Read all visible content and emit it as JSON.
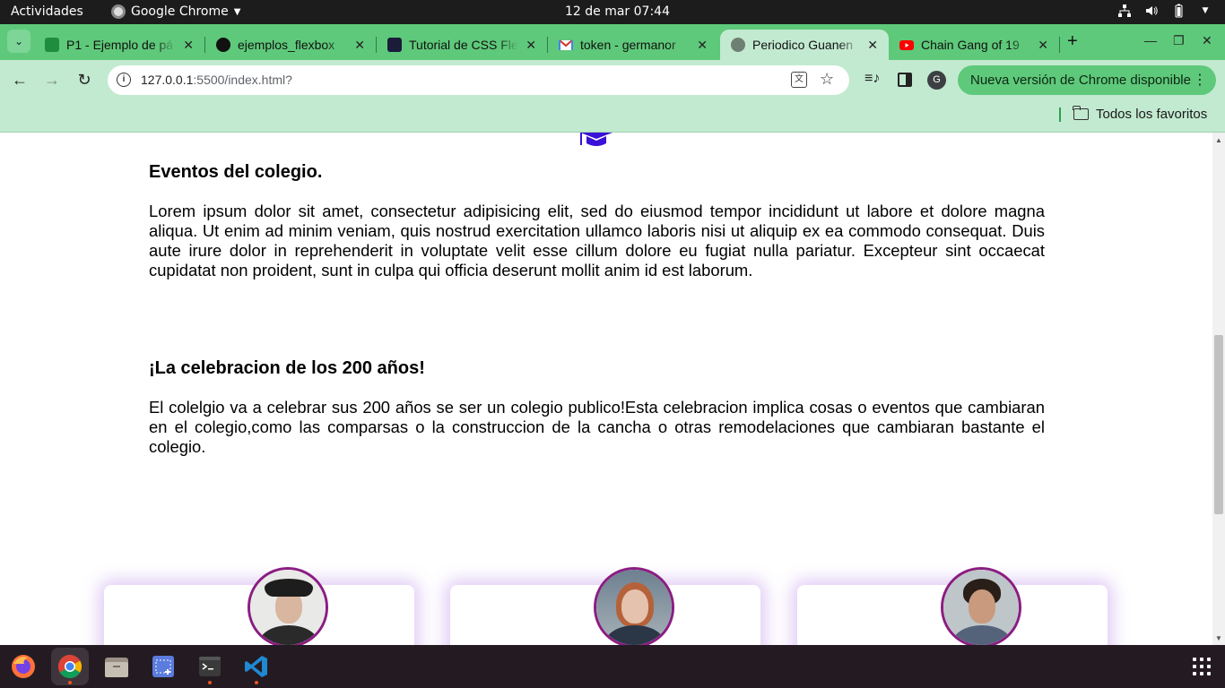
{
  "system_bar": {
    "activities": "Actividades",
    "app_name": "Google Chrome",
    "clock": "12 de mar  07:44"
  },
  "browser": {
    "tabs": [
      {
        "title": "P1 - Ejemplo de pá",
        "favicon": "google-classroom-icon",
        "color": "#1e8e3e"
      },
      {
        "title": "ejemplos_flexbox",
        "favicon": "github-icon",
        "color": "#111111"
      },
      {
        "title": "Tutorial de CSS Fle",
        "favicon": "codepen-icon",
        "color": "#1b1b3a"
      },
      {
        "title": "token - germanor",
        "favicon": "gmail-icon",
        "color": "#d93025"
      },
      {
        "title": "Periodico Guanen",
        "favicon": "globe-icon",
        "color": "#6e7f74",
        "active": true
      },
      {
        "title": "Chain Gang of 19",
        "favicon": "youtube-icon",
        "color": "#ff0000"
      }
    ],
    "url_host": "127.0.0.1",
    "url_path": ":5500/index.html?",
    "update_button": "Nueva versión de Chrome disponible",
    "profile_initial": "G",
    "bookmarks_folder": "Todos los favoritos"
  },
  "page": {
    "sections": [
      {
        "heading": "Eventos del colegio.",
        "body": "Lorem ipsum dolor sit amet, consectetur adipisicing elit, sed do eiusmod tempor incididunt ut labore et dolore magna aliqua. Ut enim ad minim veniam, quis nostrud exercitation ullamco laboris nisi ut aliquip ex ea commodo consequat. Duis aute irure dolor in reprehenderit in voluptate velit esse cillum dolore eu fugiat nulla pariatur. Excepteur sint occaecat cupidatat non proident, sunt in culpa qui officia deserunt mollit anim id est laborum."
      },
      {
        "heading": "¡La celebracion de los 200 años!",
        "body": "El colelgio va a celebrar sus 200 años se ser un colegio publico!Esta celebracion implica cosas o eventos que cambiaran en el colegio,como las comparsas o la construccion de la cancha o otras remodelaciones que cambiaran bastante el colegio."
      }
    ],
    "accent_color": "#3b10d8",
    "card_border_color": "#8b1d83"
  },
  "dock": {
    "apps": [
      "firefox-icon",
      "chrome-icon",
      "files-icon",
      "screenshot-icon",
      "terminal-icon",
      "vscode-icon"
    ]
  }
}
